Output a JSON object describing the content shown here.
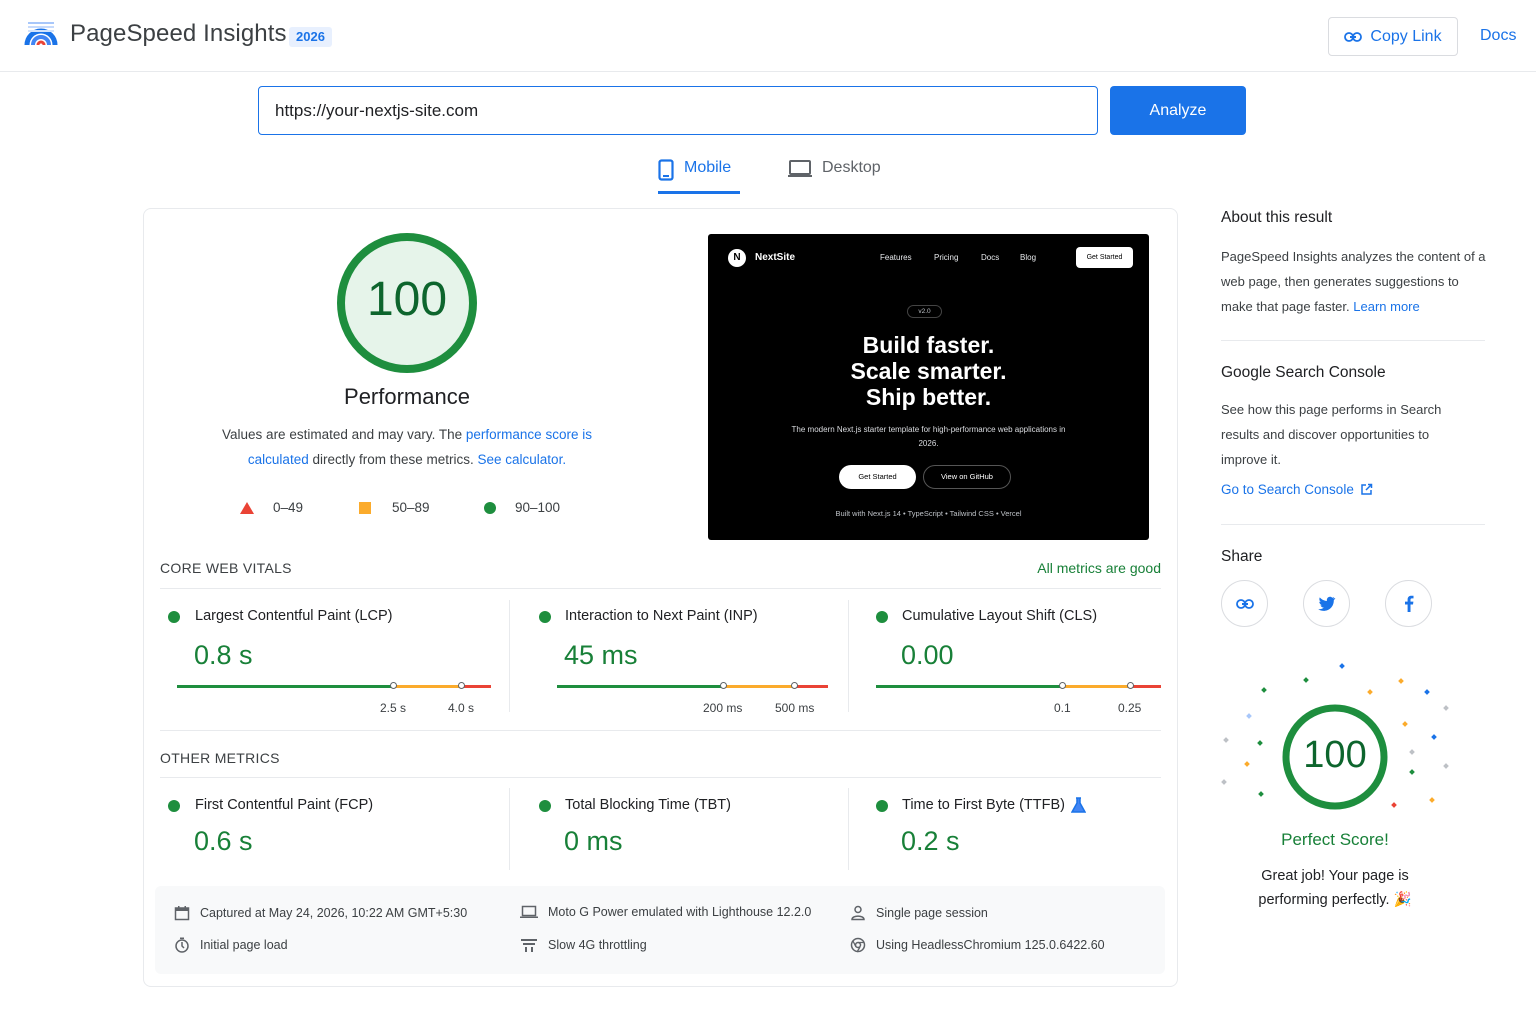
{
  "header": {
    "brand": "PageSpeed Insights",
    "year_badge": "2026",
    "copy_link_label": "Copy Link",
    "docs_label": "Docs"
  },
  "search": {
    "url_value": "https://your-nextjs-site.com",
    "analyze_label": "Analyze"
  },
  "tabs": [
    {
      "label": "Mobile",
      "active": true
    },
    {
      "label": "Desktop",
      "active": false
    }
  ],
  "performance": {
    "score": "100",
    "title": "Performance",
    "desc_prefix": "Values are estimated and may vary. The ",
    "desc_link1": "performance score is calculated",
    "desc_middle": " directly from these metrics. ",
    "desc_link2": "See calculator.",
    "legend": [
      {
        "shape": "triangle",
        "range": "0–49",
        "color": "#ea4335"
      },
      {
        "shape": "square",
        "range": "50–89",
        "color": "#fbab2c"
      },
      {
        "shape": "circle",
        "range": "90–100",
        "color": "#1e8e3e"
      }
    ]
  },
  "preview": {
    "brand": "NextSite",
    "logo_letter": "N",
    "nav": [
      "Features",
      "Pricing",
      "Docs",
      "Blog"
    ],
    "cta": "Get Started",
    "version": "v2.0",
    "headline": [
      "Build faster.",
      "Scale smarter.",
      "Ship better."
    ],
    "subtitle": "The modern Next.js starter template for high-performance web applications in 2026.",
    "btn_primary": "Get Started",
    "btn_secondary": "View on GitHub",
    "footer": "Built with Next.js 14  •  TypeScript  •  Tailwind CSS  •  Vercel"
  },
  "core_web_vitals": {
    "label": "CORE WEB VITALS",
    "status": "All metrics are good",
    "metrics": [
      {
        "name": "Largest Contentful Paint (LCP)",
        "value": "0.8 s",
        "t1": "2.5 s",
        "t2": "4.0 s"
      },
      {
        "name": "Interaction to Next Paint (INP)",
        "value": "45 ms",
        "t1": "200 ms",
        "t2": "500 ms"
      },
      {
        "name": "Cumulative Layout Shift (CLS)",
        "value": "0.00",
        "t1": "0.1",
        "t2": "0.25"
      }
    ]
  },
  "other_metrics": {
    "label": "OTHER METRICS",
    "metrics": [
      {
        "name": "First Contentful Paint (FCP)",
        "value": "0.6 s"
      },
      {
        "name": "Total Blocking Time (TBT)",
        "value": "0 ms"
      },
      {
        "name": "Time to First Byte (TTFB)",
        "value": "0.2 s"
      }
    ]
  },
  "info": {
    "captured": "Captured at May 24, 2026, 10:22 AM GMT+5:30",
    "page_load": "Initial page load",
    "device": "Moto G Power emulated with Lighthouse 12.2.0",
    "throttling": "Slow 4G throttling",
    "session": "Single page session",
    "browser": "Using HeadlessChromium 125.0.6422.60"
  },
  "sidebar": {
    "about_title": "About this result",
    "about_text": "PageSpeed Insights analyzes the content of a web page, then generates suggestions to make that page faster. ",
    "about_link": "Learn more",
    "gsc_title": "Google Search Console",
    "gsc_text": "See how this page performs in Search results and discover opportunities to improve it.",
    "gsc_link": "Go to Search Console",
    "share_title": "Share",
    "celebration_score": "100",
    "perfect_label": "Perfect Score!",
    "great_text": "Great job! Your page is performing perfectly. 🎉"
  },
  "colors": {
    "accent": "#1a73e8",
    "good": "#1e8e3e",
    "average": "#fbab2c",
    "poor": "#ea4335"
  }
}
